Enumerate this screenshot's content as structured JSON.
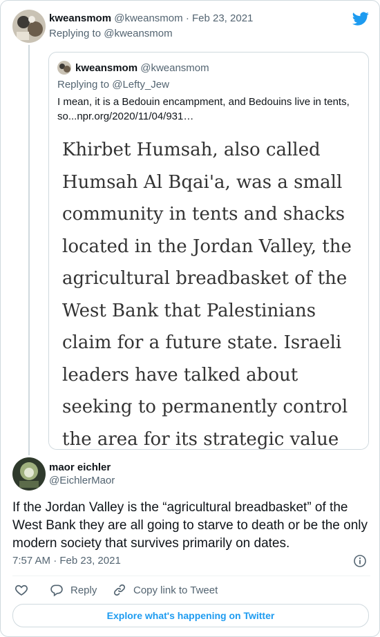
{
  "parent": {
    "name": "kweansmom",
    "handle": "@kweansmom",
    "separator": "·",
    "date": "Feb 23, 2021",
    "reply_prefix": "Replying to",
    "reply_to": "@kweansmom"
  },
  "quote": {
    "name": "kweansmom",
    "handle": "@kweansmom",
    "reply_prefix": "Replying to",
    "reply_to": "@Lefty_Jew",
    "text": "I mean, it is a Bedouin encampment, and Bedouins live in tents, so...npr.org/2020/11/04/931…",
    "image_lines": [
      "Khirbet Humsah, also called",
      "Humsah Al Bqai'a, was a small",
      "community in tents and shacks",
      "located in the Jordan Valley, the",
      "agricultural breadbasket of the",
      "West Bank that Palestinians",
      "claim for a future state. Israeli",
      "leaders have talked about",
      "seeking to permanently control",
      "the area for its strategic value"
    ]
  },
  "tweet": {
    "name": "maor eichler",
    "handle": "@EichlerMaor",
    "text": "If the Jordan Valley is the “agricultural breadbasket” of the West Bank they are all going to starve to death or be the only modern society that survives primarily on dates.",
    "time": "7:57 AM",
    "separator": "·",
    "date": "Feb 23, 2021"
  },
  "actions": {
    "reply": "Reply",
    "copy_link": "Copy link to Tweet"
  },
  "explore": "Explore what's happening on Twitter",
  "icons": {
    "brand": "twitter-bird-icon",
    "like": "heart-icon",
    "reply": "reply-bubble-icon",
    "copy": "link-icon",
    "info": "info-icon"
  },
  "colors": {
    "accent": "#1d9bf0",
    "text": "#0f1419",
    "muted": "#536471",
    "border": "#cfd9de"
  }
}
